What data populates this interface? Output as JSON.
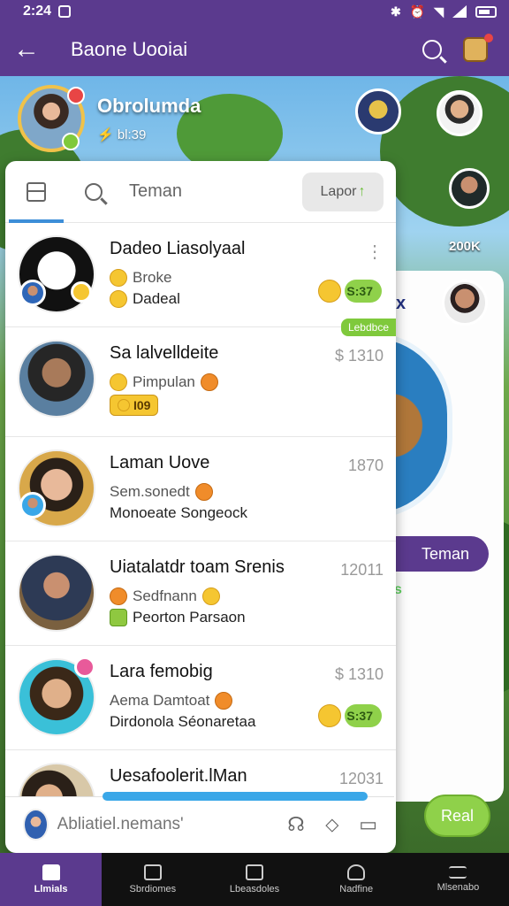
{
  "status_bar": {
    "time": "2:24",
    "battery_icon": "battery-icon"
  },
  "app_bar": {
    "title": "Baone Uooiai"
  },
  "profile": {
    "name": "Obrolumda",
    "subtitle": "⚡ bl:39"
  },
  "right_panel": {
    "count": "200K",
    "x": "x",
    "teman_button": "Teman",
    "green_label": "s",
    "real_button": "Real"
  },
  "tabs": {
    "label": "Teman",
    "lapor_label": "Lapor"
  },
  "contacts": [
    {
      "name": "Dadeo Liasolyaal",
      "line2": "Broke",
      "line3": "Dadeal",
      "time": "",
      "pill": "S:37"
    },
    {
      "name": "Sa lalvelldeite",
      "line2": "Pimpulan",
      "line3": "I09",
      "time": "$ 1310",
      "pill": ""
    },
    {
      "name": "Laman Uove",
      "line2": "Sem.sonedt",
      "line3": "Monoeate Songeock",
      "time": "1870",
      "pill": ""
    },
    {
      "name": "Uiatalatdr toam Srenis",
      "line2": "Sedfnann",
      "line3": "Peorton Parsaon",
      "time": "12011",
      "pill": ""
    },
    {
      "name": "Lara femobig",
      "line2": "Aema Damtoat",
      "line3": "Dirdonola Séonaretaa",
      "time": "$ 1310",
      "pill": "S:37"
    },
    {
      "name": "Uesafoolerit.lMan",
      "line2": "",
      "line3": "",
      "time": "12031",
      "pill": ""
    }
  ],
  "green_tag": "Lebdbce",
  "bottom_search": {
    "placeholder": "Abliatiel.nemans'"
  },
  "nav": [
    {
      "label": "Llmials",
      "icon": "home-icon"
    },
    {
      "label": "Sbrdiomes",
      "icon": "image-icon"
    },
    {
      "label": "Lbeasdoles",
      "icon": "bag-icon"
    },
    {
      "label": "Nadfine",
      "icon": "person-icon"
    },
    {
      "label": "Mlsenabo",
      "icon": "menu-icon"
    }
  ],
  "colors": {
    "primary": "#5b3a8e",
    "accent_green": "#8fd14a",
    "tab_indicator": "#3d8ed8"
  }
}
